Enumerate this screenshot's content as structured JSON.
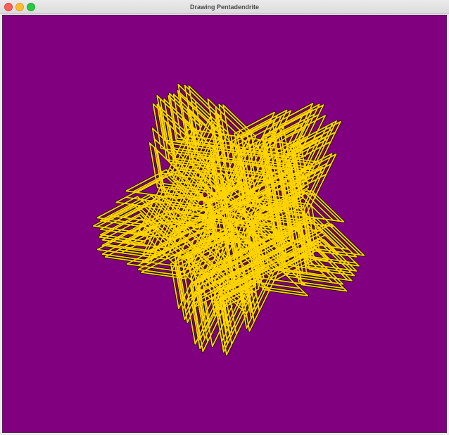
{
  "window": {
    "title": "Drawing Pentadendrite"
  },
  "canvas": {
    "background_color": "#800080",
    "fractal_name": "Pentadendrite",
    "stroke_color": "#ffd400",
    "outline_color": "#1a0a00"
  }
}
